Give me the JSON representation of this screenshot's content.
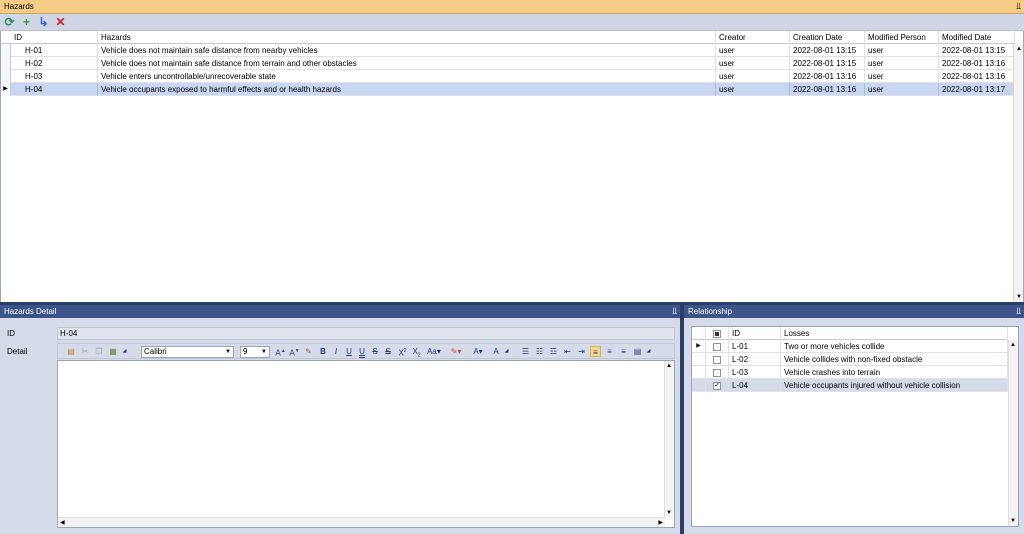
{
  "hazards_panel": {
    "title": "Hazards",
    "pin_glyph": "⫫",
    "toolbar": {
      "refresh_icon": "refresh-icon",
      "add_icon": "add-icon",
      "insert_icon": "insert-child-icon",
      "delete_icon": "delete-icon",
      "colors": {
        "refresh": "#2e8b57",
        "add": "#2e9e3a",
        "insert": "#2f64c8",
        "delete": "#cc2222"
      }
    },
    "columns": [
      "ID",
      "Hazards",
      "Creator",
      "Creation Date",
      "Modified Person",
      "Modified Date"
    ],
    "rows": [
      {
        "id": "H-01",
        "hazard": "Vehicle does not maintain safe distance from nearby vehicles",
        "creator": "user",
        "created": "2022-08-01 13:15",
        "modified_by": "user",
        "modified": "2022-08-01 13:15"
      },
      {
        "id": "H-02",
        "hazard": "Vehicle does not maintain safe distance from terrain and other obstacles",
        "creator": "user",
        "created": "2022-08-01 13:15",
        "modified_by": "user",
        "modified": "2022-08-01 13:16"
      },
      {
        "id": "H-03",
        "hazard": "Vehicle enters uncontrollable/unrecoverable state",
        "creator": "user",
        "created": "2022-08-01 13:16",
        "modified_by": "user",
        "modified": "2022-08-01 13:16"
      },
      {
        "id": "H-04",
        "hazard": "Vehicle occupants exposed to harmful effects and or health hazards",
        "creator": "user",
        "created": "2022-08-01 13:16",
        "modified_by": "user",
        "modified": "2022-08-01 13:17"
      }
    ],
    "selected_row": 3
  },
  "detail_panel": {
    "title": "Hazards Detail",
    "id_label": "ID",
    "id_value": "H-04",
    "detail_label": "Detail",
    "font_name": "Calibri",
    "font_size": "9",
    "content": ""
  },
  "relationship_panel": {
    "title": "Relationship",
    "columns": [
      "ID",
      "Losses"
    ],
    "rows": [
      {
        "id": "L-01",
        "loss": "Two or more vehicles collide",
        "checked": false
      },
      {
        "id": "L-02",
        "loss": "Vehicle collides with non-fixed obstacle",
        "checked": false
      },
      {
        "id": "L-03",
        "loss": "Vehicle crashes into terrain",
        "checked": false
      },
      {
        "id": "L-04",
        "loss": "Vehicle occupants injured without vehicle collision",
        "checked": true
      }
    ],
    "current_row": 0,
    "selected_row": 3
  }
}
